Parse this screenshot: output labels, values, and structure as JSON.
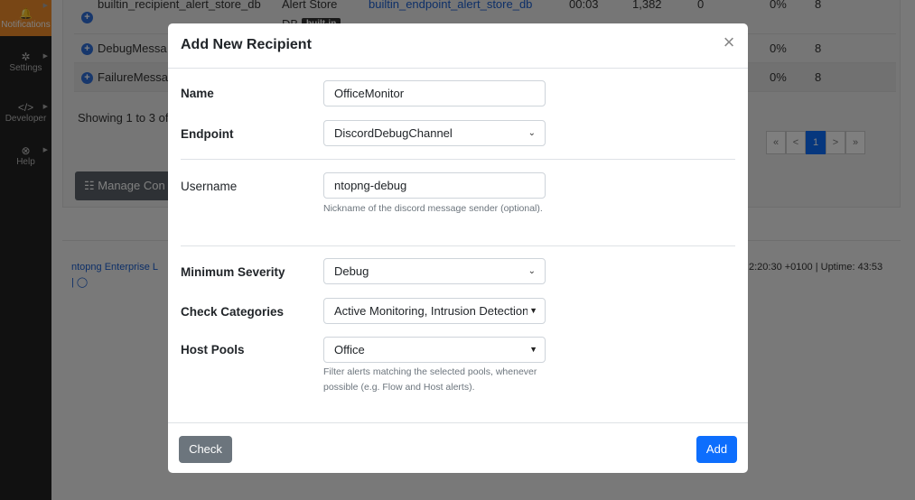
{
  "sidebar": {
    "items": [
      {
        "icon": "bell-icon",
        "label": "Notifications",
        "glyph": "🔔"
      },
      {
        "icon": "gear-icon",
        "label": "Settings",
        "glyph": "✲"
      },
      {
        "icon": "code-icon",
        "label": "Developer",
        "glyph": "</>"
      },
      {
        "icon": "help-icon",
        "label": "Help",
        "glyph": "⊗"
      }
    ]
  },
  "background": {
    "rows": [
      {
        "name": "builtin_recipient_alert_store_db",
        "endpoint_type": "Alert Store",
        "endpoint_type2": "DB",
        "badge": "built-in",
        "endpoint": "builtin_endpoint_alert_store_db",
        "time": "00:03",
        "count": "1,382",
        "zero": "0",
        "pct": "0%",
        "num": "8"
      },
      {
        "name": "DebugMessa",
        "pct": "0%",
        "num": "8"
      },
      {
        "name": "FailureMessa",
        "pct": "0%",
        "num": "8"
      }
    ],
    "showing": "Showing 1 to 3 of",
    "pager": [
      "«",
      "<",
      "1",
      ">",
      "»"
    ],
    "manage_button": "☷ Manage Con",
    "footer_left": "ntopng Enterprise L",
    "footer_left2": "| ◯",
    "footer_right": "2:20:30 +0100 | Uptime: 43:53"
  },
  "modal": {
    "title": "Add New Recipient",
    "close": "×",
    "name_label": "Name",
    "name_value": "OfficeMonitor",
    "endpoint_label": "Endpoint",
    "endpoint_value": "DiscordDebugChannel",
    "username_label": "Username",
    "username_value": "ntopng-debug",
    "username_help": "Nickname of the discord message sender (optional).",
    "severity_label": "Minimum Severity",
    "severity_value": "Debug",
    "categories_label": "Check Categories",
    "categories_value": "Active Monitoring, Intrusion Detection",
    "pools_label": "Host Pools",
    "pools_value": "Office",
    "pools_help": "Filter alerts matching the selected pools, whenever possible (e.g. Flow and Host alerts).",
    "check_button": "Check",
    "add_button": "Add"
  },
  "colors": {
    "accent": "#0d6efd",
    "sidebar_active": "#f08c2b",
    "secondary": "#6c757d"
  }
}
